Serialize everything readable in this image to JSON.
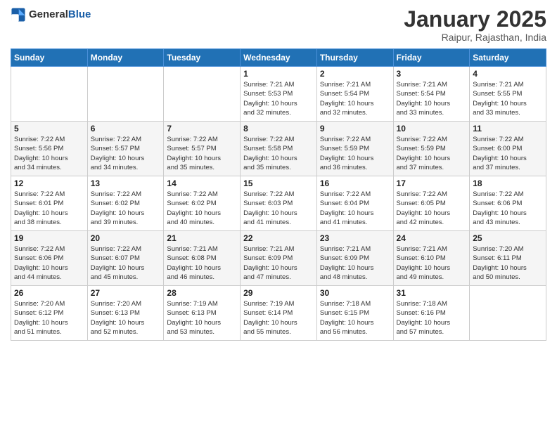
{
  "header": {
    "logo": {
      "general": "General",
      "blue": "Blue"
    },
    "title": "January 2025",
    "location": "Raipur, Rajasthan, India"
  },
  "weekdays": [
    "Sunday",
    "Monday",
    "Tuesday",
    "Wednesday",
    "Thursday",
    "Friday",
    "Saturday"
  ],
  "weeks": [
    [
      {
        "day": "",
        "info": ""
      },
      {
        "day": "",
        "info": ""
      },
      {
        "day": "",
        "info": ""
      },
      {
        "day": "1",
        "info": "Sunrise: 7:21 AM\nSunset: 5:53 PM\nDaylight: 10 hours\nand 32 minutes."
      },
      {
        "day": "2",
        "info": "Sunrise: 7:21 AM\nSunset: 5:54 PM\nDaylight: 10 hours\nand 32 minutes."
      },
      {
        "day": "3",
        "info": "Sunrise: 7:21 AM\nSunset: 5:54 PM\nDaylight: 10 hours\nand 33 minutes."
      },
      {
        "day": "4",
        "info": "Sunrise: 7:21 AM\nSunset: 5:55 PM\nDaylight: 10 hours\nand 33 minutes."
      }
    ],
    [
      {
        "day": "5",
        "info": "Sunrise: 7:22 AM\nSunset: 5:56 PM\nDaylight: 10 hours\nand 34 minutes."
      },
      {
        "day": "6",
        "info": "Sunrise: 7:22 AM\nSunset: 5:57 PM\nDaylight: 10 hours\nand 34 minutes."
      },
      {
        "day": "7",
        "info": "Sunrise: 7:22 AM\nSunset: 5:57 PM\nDaylight: 10 hours\nand 35 minutes."
      },
      {
        "day": "8",
        "info": "Sunrise: 7:22 AM\nSunset: 5:58 PM\nDaylight: 10 hours\nand 35 minutes."
      },
      {
        "day": "9",
        "info": "Sunrise: 7:22 AM\nSunset: 5:59 PM\nDaylight: 10 hours\nand 36 minutes."
      },
      {
        "day": "10",
        "info": "Sunrise: 7:22 AM\nSunset: 5:59 PM\nDaylight: 10 hours\nand 37 minutes."
      },
      {
        "day": "11",
        "info": "Sunrise: 7:22 AM\nSunset: 6:00 PM\nDaylight: 10 hours\nand 37 minutes."
      }
    ],
    [
      {
        "day": "12",
        "info": "Sunrise: 7:22 AM\nSunset: 6:01 PM\nDaylight: 10 hours\nand 38 minutes."
      },
      {
        "day": "13",
        "info": "Sunrise: 7:22 AM\nSunset: 6:02 PM\nDaylight: 10 hours\nand 39 minutes."
      },
      {
        "day": "14",
        "info": "Sunrise: 7:22 AM\nSunset: 6:02 PM\nDaylight: 10 hours\nand 40 minutes."
      },
      {
        "day": "15",
        "info": "Sunrise: 7:22 AM\nSunset: 6:03 PM\nDaylight: 10 hours\nand 41 minutes."
      },
      {
        "day": "16",
        "info": "Sunrise: 7:22 AM\nSunset: 6:04 PM\nDaylight: 10 hours\nand 41 minutes."
      },
      {
        "day": "17",
        "info": "Sunrise: 7:22 AM\nSunset: 6:05 PM\nDaylight: 10 hours\nand 42 minutes."
      },
      {
        "day": "18",
        "info": "Sunrise: 7:22 AM\nSunset: 6:06 PM\nDaylight: 10 hours\nand 43 minutes."
      }
    ],
    [
      {
        "day": "19",
        "info": "Sunrise: 7:22 AM\nSunset: 6:06 PM\nDaylight: 10 hours\nand 44 minutes."
      },
      {
        "day": "20",
        "info": "Sunrise: 7:22 AM\nSunset: 6:07 PM\nDaylight: 10 hours\nand 45 minutes."
      },
      {
        "day": "21",
        "info": "Sunrise: 7:21 AM\nSunset: 6:08 PM\nDaylight: 10 hours\nand 46 minutes."
      },
      {
        "day": "22",
        "info": "Sunrise: 7:21 AM\nSunset: 6:09 PM\nDaylight: 10 hours\nand 47 minutes."
      },
      {
        "day": "23",
        "info": "Sunrise: 7:21 AM\nSunset: 6:09 PM\nDaylight: 10 hours\nand 48 minutes."
      },
      {
        "day": "24",
        "info": "Sunrise: 7:21 AM\nSunset: 6:10 PM\nDaylight: 10 hours\nand 49 minutes."
      },
      {
        "day": "25",
        "info": "Sunrise: 7:20 AM\nSunset: 6:11 PM\nDaylight: 10 hours\nand 50 minutes."
      }
    ],
    [
      {
        "day": "26",
        "info": "Sunrise: 7:20 AM\nSunset: 6:12 PM\nDaylight: 10 hours\nand 51 minutes."
      },
      {
        "day": "27",
        "info": "Sunrise: 7:20 AM\nSunset: 6:13 PM\nDaylight: 10 hours\nand 52 minutes."
      },
      {
        "day": "28",
        "info": "Sunrise: 7:19 AM\nSunset: 6:13 PM\nDaylight: 10 hours\nand 53 minutes."
      },
      {
        "day": "29",
        "info": "Sunrise: 7:19 AM\nSunset: 6:14 PM\nDaylight: 10 hours\nand 55 minutes."
      },
      {
        "day": "30",
        "info": "Sunrise: 7:18 AM\nSunset: 6:15 PM\nDaylight: 10 hours\nand 56 minutes."
      },
      {
        "day": "31",
        "info": "Sunrise: 7:18 AM\nSunset: 6:16 PM\nDaylight: 10 hours\nand 57 minutes."
      },
      {
        "day": "",
        "info": ""
      }
    ]
  ]
}
